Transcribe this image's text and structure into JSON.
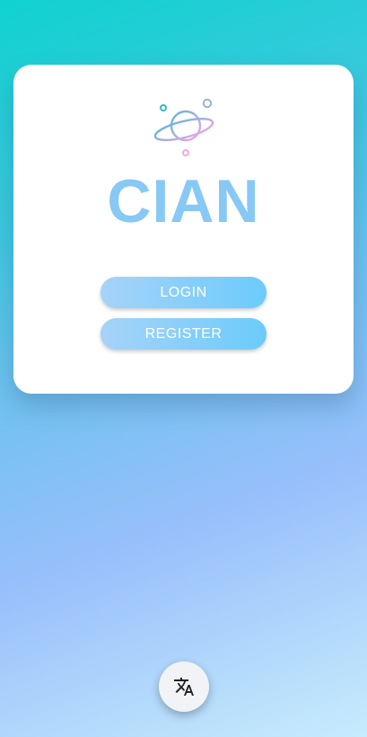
{
  "app": {
    "brand_name": "CIAN",
    "logo_icon": "planet-icon"
  },
  "actions": {
    "login_label": "LOGIN",
    "register_label": "REGISTER"
  },
  "fab": {
    "icon": "translate-icon"
  },
  "colors": {
    "brand_text": "#88c8f5",
    "button_gradient_start": "#a6d3f8",
    "button_gradient_end": "#6ccbfb",
    "background_top": "#10d2cf",
    "background_bottom": "#c7ecfd"
  }
}
